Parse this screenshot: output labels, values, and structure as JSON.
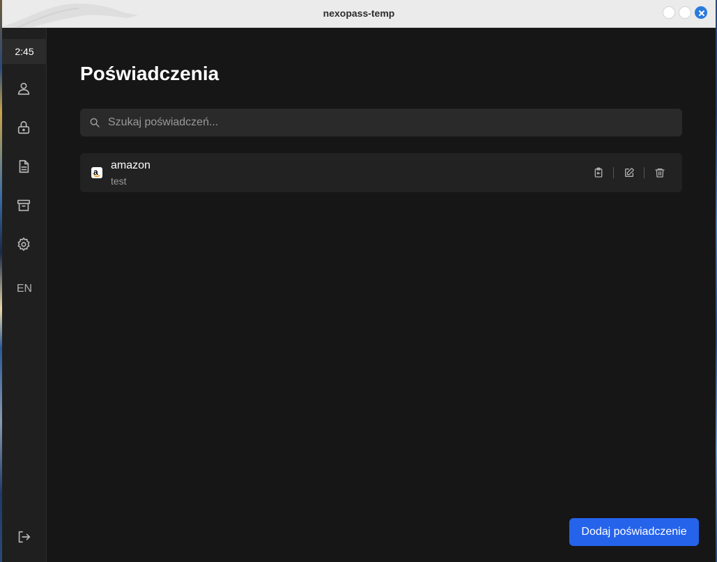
{
  "window": {
    "title": "nexopass-temp"
  },
  "sidebar": {
    "clock": "2:45",
    "items": [
      {
        "icon": "user-icon"
      },
      {
        "icon": "lock-icon"
      },
      {
        "icon": "document-icon"
      },
      {
        "icon": "archive-icon"
      },
      {
        "icon": "gear-icon"
      }
    ],
    "language": "EN",
    "logout_icon": "logout-icon"
  },
  "main": {
    "title": "Poświadczenia",
    "search": {
      "placeholder": "Szukaj poświadczeń...",
      "value": ""
    },
    "credentials": [
      {
        "name": "amazon",
        "username": "test",
        "icon": "amazon-icon"
      }
    ],
    "add_button": "Dodaj poświadczenie"
  },
  "colors": {
    "accent": "#2563eb",
    "background": "#161616",
    "sidebar": "#1f1f1f",
    "card": "#222222"
  }
}
